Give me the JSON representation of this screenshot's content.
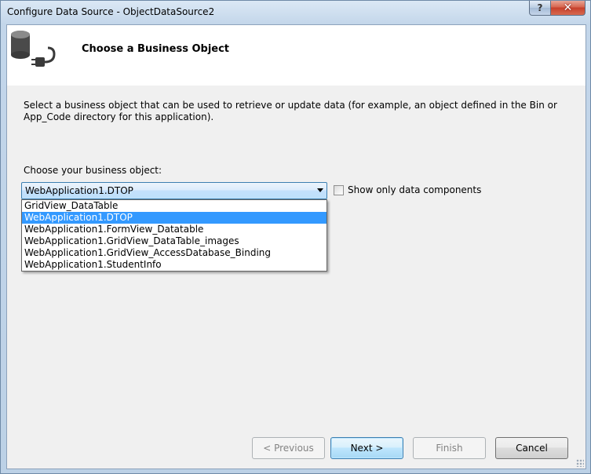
{
  "window": {
    "title": "Configure Data Source - ObjectDataSource2",
    "help_label": "?",
    "close_label": "✕"
  },
  "header": {
    "title": "Choose a Business Object",
    "icon": "database-plug-icon"
  },
  "description": "Select a business object that can be used to retrieve or update data (for example, an object defined in the Bin or App_Code directory for this application).",
  "business_object": {
    "label": "Choose your business object:",
    "selected": "WebApplication1.DTOP",
    "options": [
      "GridView_DataTable",
      "WebApplication1.DTOP",
      "WebApplication1.FormView_Datatable",
      "WebApplication1.GridView_DataTable_images",
      "WebApplication1.GridView_AccessDatabase_Binding",
      "WebApplication1.StudentInfo"
    ],
    "highlighted_index": 1
  },
  "show_only_data_components": {
    "label": "Show only data components",
    "checked": false
  },
  "buttons": {
    "previous": "< Previous",
    "next": "Next >",
    "finish": "Finish",
    "cancel": "Cancel"
  },
  "colors": {
    "selection": "#3399ff",
    "header_bg": "#ffffff",
    "client_bg": "#f0f0f0"
  }
}
